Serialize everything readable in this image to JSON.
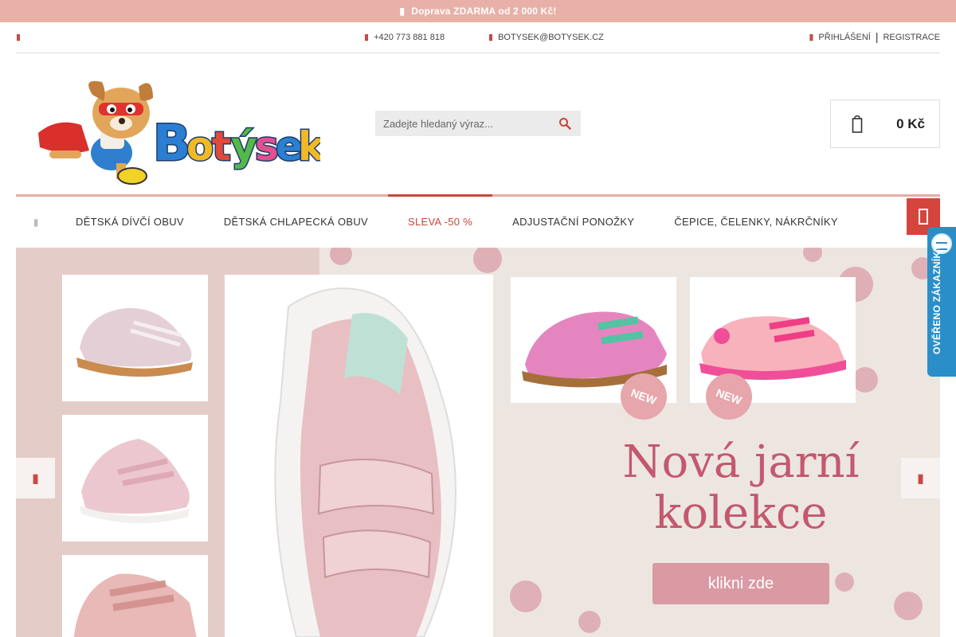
{
  "promo": {
    "text": "Doprava ZDARMA od 2 000 Kč!",
    "icon": "truck-icon"
  },
  "util": {
    "phone": "+420 773 881 818",
    "email": "BOTYSEK@BOTYSEK.CZ",
    "login": "PŘIHLÁŠENÍ",
    "separator": "|",
    "register": "REGISTRACE"
  },
  "logo": {
    "text": "Botýsek"
  },
  "search": {
    "placeholder": "Zadejte hledaný výraz..."
  },
  "cart": {
    "total": "0 Kč"
  },
  "nav": {
    "items": [
      {
        "label": "DĚTSKÁ DÍVČÍ OBUV"
      },
      {
        "label": "DĚTSKÁ CHLAPECKÁ OBUV"
      },
      {
        "label": "SLEVA -50 %",
        "active": true
      },
      {
        "label": "ADJUSTAČNÍ PONOŽKY"
      },
      {
        "label": "ČEPICE, ČELENKY, NÁKRČNÍKY"
      }
    ]
  },
  "badge": {
    "text": "OVĚŘENO ZÁKAZNÍKY"
  },
  "banner": {
    "headline_line1": "Nová jarní",
    "headline_line2": "kolekce",
    "cta": "klikni zde",
    "new_label": "NEW"
  },
  "colors": {
    "promo": "#e8b0a7",
    "accent": "#c9463c",
    "badge": "#2a8fc9",
    "headline": "#c3586f"
  }
}
